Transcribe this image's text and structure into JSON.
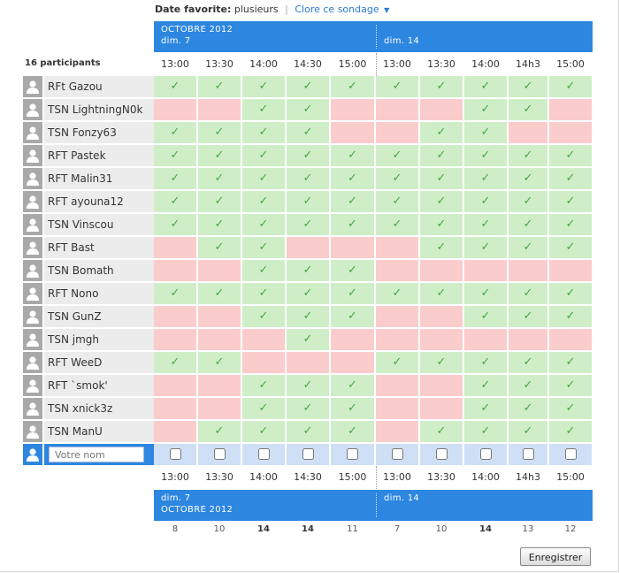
{
  "header": {
    "fav_label": "Date favorite:",
    "fav_value": "plusieurs",
    "sep": "|",
    "close_label": "Clore ce sondage",
    "caret": "▼"
  },
  "top_band": {
    "month": "OCTOBRE 2012",
    "day1": "dim. 7",
    "day2": "dim. 14"
  },
  "bottom_band": {
    "day1": "dim. 7",
    "month": "OCTOBRE 2012",
    "day2": "dim. 14"
  },
  "participants_label": "16 participants",
  "times": [
    "13:00",
    "13:30",
    "14:00",
    "14:30",
    "15:00",
    "13:00",
    "13:30",
    "14:00",
    "14h3",
    "15:00"
  ],
  "check_glyph": "✓",
  "participants": [
    {
      "name": "RFt Gazou",
      "votes": [
        1,
        1,
        1,
        1,
        1,
        1,
        1,
        1,
        1,
        1
      ]
    },
    {
      "name": "TSN LightningN0k",
      "votes": [
        0,
        0,
        1,
        1,
        0,
        0,
        0,
        1,
        1,
        0
      ]
    },
    {
      "name": "TSN Fonzy63",
      "votes": [
        1,
        1,
        1,
        1,
        0,
        0,
        1,
        1,
        0,
        0
      ]
    },
    {
      "name": "RFT Pastek",
      "votes": [
        1,
        1,
        1,
        1,
        1,
        1,
        1,
        1,
        1,
        1
      ]
    },
    {
      "name": "RFT Malin31",
      "votes": [
        1,
        1,
        1,
        1,
        1,
        1,
        1,
        1,
        1,
        1
      ]
    },
    {
      "name": "RFT ayouna12",
      "votes": [
        1,
        1,
        1,
        1,
        1,
        1,
        1,
        1,
        1,
        1
      ]
    },
    {
      "name": "TSN Vinscou",
      "votes": [
        1,
        1,
        1,
        1,
        1,
        1,
        1,
        1,
        1,
        1
      ]
    },
    {
      "name": "RFT Bast",
      "votes": [
        0,
        1,
        1,
        0,
        0,
        0,
        1,
        1,
        1,
        1
      ]
    },
    {
      "name": "TSN Bomath",
      "votes": [
        0,
        0,
        1,
        1,
        1,
        0,
        0,
        0,
        0,
        0
      ]
    },
    {
      "name": "RFT Nono",
      "votes": [
        1,
        1,
        1,
        1,
        1,
        1,
        1,
        1,
        1,
        1
      ]
    },
    {
      "name": "TSN GunZ",
      "votes": [
        0,
        0,
        1,
        1,
        1,
        0,
        0,
        1,
        1,
        1
      ]
    },
    {
      "name": "TSN jmgh",
      "votes": [
        0,
        0,
        0,
        1,
        0,
        0,
        0,
        0,
        0,
        0
      ]
    },
    {
      "name": "RFT WeeD",
      "votes": [
        1,
        1,
        0,
        0,
        0,
        1,
        1,
        1,
        1,
        1
      ]
    },
    {
      "name": "RFT `smok'",
      "votes": [
        0,
        0,
        1,
        1,
        1,
        0,
        0,
        1,
        1,
        1
      ]
    },
    {
      "name": "TSN xnick3z",
      "votes": [
        0,
        0,
        1,
        1,
        1,
        0,
        0,
        1,
        1,
        1
      ]
    },
    {
      "name": "TSN ManU",
      "votes": [
        0,
        1,
        1,
        1,
        1,
        0,
        1,
        1,
        1,
        1
      ]
    }
  ],
  "new_row": {
    "placeholder": "Votre nom"
  },
  "counts": [
    "8",
    "10",
    "14",
    "14",
    "11",
    "7",
    "10",
    "14",
    "13",
    "12"
  ],
  "best_counts": [
    false,
    false,
    true,
    true,
    false,
    false,
    false,
    true,
    false,
    false
  ],
  "save_label": "Enregistrer"
}
